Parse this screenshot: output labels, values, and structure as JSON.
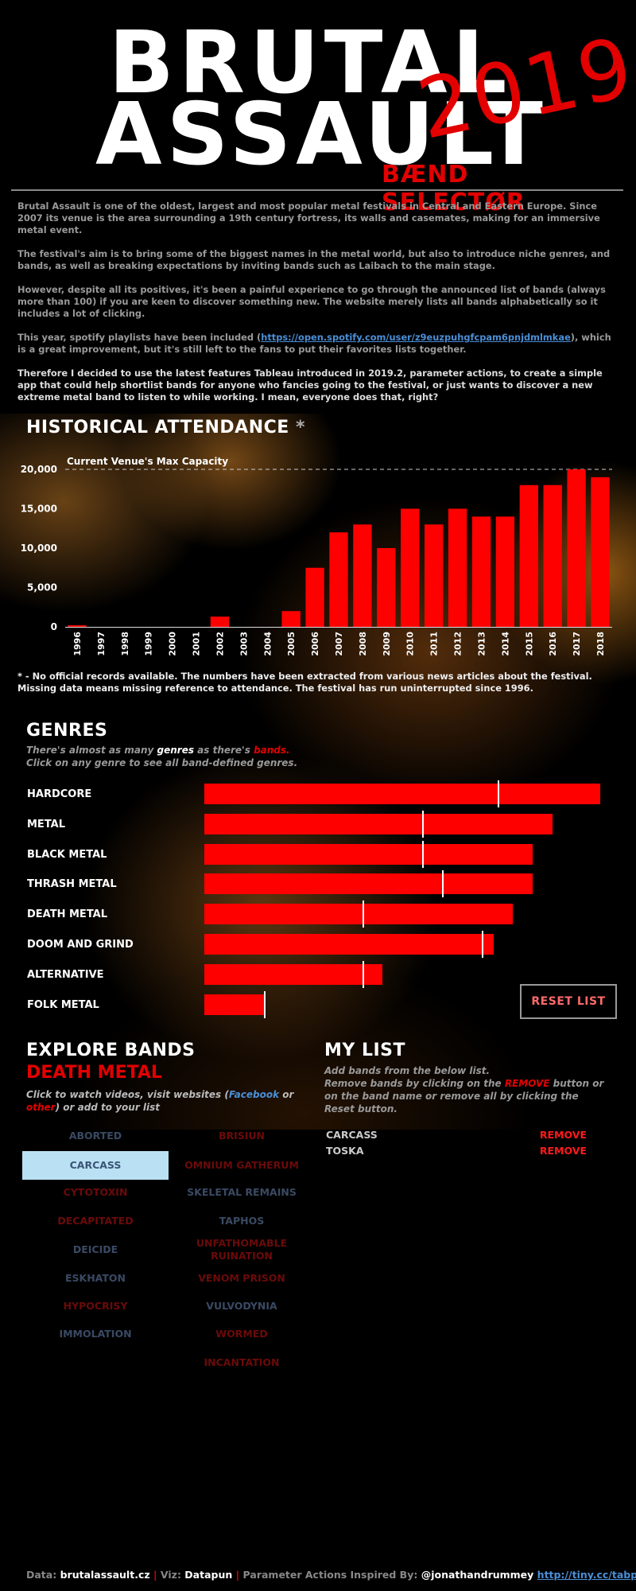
{
  "header": {
    "logo_line1": "BRUTAL",
    "logo_line2": "ASSAULT",
    "logo_year": "2019",
    "logo_subtitle": "BÆND SELECTØR"
  },
  "intro": {
    "p1": "Brutal Assault is one of the oldest, largest and most popular metal festivals in Central and Eastern Europe. Since 2007 its venue is the area surrounding a 19th century fortress, its walls and casemates, making for an immersive metal event.",
    "p2": "The festival's aim is to bring some of the biggest names in the metal world, but also to introduce niche genres, and bands, as well as breaking expectations by inviting bands such as Laibach to the main stage.",
    "p3": "However, despite all its positives, it's been a painful experience to go through the announced list of bands (always more than 100) if you are keen to discover something  new. The website merely lists all bands alphabetically so it includes a lot of clicking.",
    "p4_a": "This year, spotify playlists have been included (",
    "p4_link": "https://open.spotify.com/user/z9euzpuhgfcpam6pnjdmlmkae",
    "p4_b": "), which is a great improvement, but it's still left to the fans to put their favorites lists together.",
    "p5": "Therefore I decided to use the latest features Tableau introduced in 2019.2, parameter actions, to create a simple app that could help shortlist bands for anyone who fancies going to the festival, or just wants to discover a new extreme metal band to listen to while working. I mean, everyone does that, right?"
  },
  "attendance": {
    "title": "HISTORICAL ATTENDANCE",
    "title_star": "*",
    "footnote": "* - No official records available. The numbers have been extracted from various news articles about the festival. Missing data means missing reference to attendance. The festival has run uninterrupted since 1996."
  },
  "chart_data": {
    "type": "bar",
    "title": "HISTORICAL ATTENDANCE",
    "categories": [
      "1996",
      "1997",
      "1998",
      "1999",
      "2000",
      "2001",
      "2002",
      "2003",
      "2004",
      "2005",
      "2006",
      "2007",
      "2008",
      "2009",
      "2010",
      "2011",
      "2012",
      "2013",
      "2014",
      "2015",
      "2016",
      "2017",
      "2018"
    ],
    "values": [
      200,
      null,
      null,
      null,
      null,
      null,
      1300,
      null,
      null,
      2000,
      7500,
      12000,
      13000,
      10000,
      15000,
      13000,
      15000,
      14000,
      14000,
      18000,
      18000,
      20000,
      19000
    ],
    "yticks": [
      0,
      5000,
      10000,
      15000,
      20000
    ],
    "ytick_labels": [
      "0",
      "5,000",
      "10,000",
      "15,000",
      "20,000"
    ],
    "ylim": [
      0,
      20000
    ],
    "reference_line": {
      "value": 20000,
      "label": "Current Venue's Max Capacity"
    },
    "bar_color": "#ff0000",
    "grid": false
  },
  "genres": {
    "title": "GENRES",
    "sub1_a": "There's almost as many ",
    "sub1_genres": "genres",
    "sub1_b": " as there's ",
    "sub1_bands": "bands.",
    "sub2": "Click on any genre to see all band-defined genres.",
    "items": [
      {
        "label": "HARDCORE",
        "value": 1.0,
        "ref": 0.74
      },
      {
        "label": "METAL",
        "value": 0.88,
        "ref": 0.55
      },
      {
        "label": "BLACK METAL",
        "value": 0.83,
        "ref": 0.55
      },
      {
        "label": "THRASH METAL",
        "value": 0.83,
        "ref": 0.6
      },
      {
        "label": "DEATH METAL",
        "value": 0.78,
        "ref": 0.4
      },
      {
        "label": "DOOM AND GRIND",
        "value": 0.73,
        "ref": 0.7
      },
      {
        "label": "ALTERNATIVE",
        "value": 0.45,
        "ref": 0.4
      },
      {
        "label": "FOLK METAL",
        "value": 0.15,
        "ref": 0.15
      }
    ],
    "reset_label": "RESET LIST"
  },
  "explore": {
    "title": "EXPLORE BANDS",
    "selected_genre": "DEATH METAL",
    "sub_a": "Click to watch videos, visit websites (",
    "sub_facebook": "Facebook",
    "sub_or": " or ",
    "sub_other": "other",
    "sub_b": ") or add to your list",
    "col1": [
      {
        "name": "ABORTED",
        "style": "blue"
      },
      {
        "name": "CARCASS",
        "style": "sel"
      },
      {
        "name": "CYTOTOXIN",
        "style": "red"
      },
      {
        "name": "DECAPITATED",
        "style": "red"
      },
      {
        "name": "DEICIDE",
        "style": "blue"
      },
      {
        "name": "ESKHATON",
        "style": "blue"
      },
      {
        "name": "HYPOCRISY",
        "style": "red"
      },
      {
        "name": "IMMOLATION",
        "style": "blue"
      }
    ],
    "col2": [
      {
        "name": "BRISIUN",
        "style": "red"
      },
      {
        "name": "OMNIUM GATHERUM",
        "style": "red"
      },
      {
        "name": "SKELETAL REMAINS",
        "style": "blue"
      },
      {
        "name": "TAPHOS",
        "style": "blue"
      },
      {
        "name": "UNFATHOMABLE RUINATION",
        "style": "red"
      },
      {
        "name": "VENOM PRISON",
        "style": "red"
      },
      {
        "name": "VULVODYNIA",
        "style": "blue"
      },
      {
        "name": "WORMED",
        "style": "red"
      },
      {
        "name": "INCANTATION",
        "style": "red"
      }
    ]
  },
  "mylist": {
    "title": "MY LIST",
    "sub_a": "Add bands from the below list.",
    "sub_b": "Remove bands by clicking on the ",
    "sub_remove": "REMOVE",
    "sub_c": " button or on the band name or remove all by clicking the Reset button.",
    "items": [
      {
        "name": "CARCASS",
        "action": "REMOVE"
      },
      {
        "name": "TOSKA",
        "action": "REMOVE"
      }
    ]
  },
  "footer": {
    "data_label": "Data: ",
    "data_value": "brutalassault.cz",
    "sep": "|",
    "viz_label": " Viz: ",
    "viz_value": "Datapun",
    "inspired_label": " Parameter Actions Inspired By: ",
    "inspired_value": "@jonathandrummey",
    "link": "http://tiny.cc/tabparam"
  },
  "colors": {
    "accent": "#e30000",
    "bar": "#ff0000",
    "link": "#4a8fd8"
  }
}
